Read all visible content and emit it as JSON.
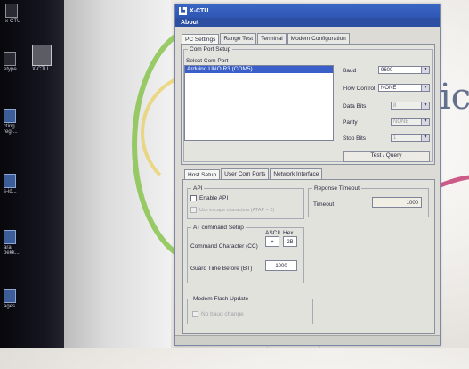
{
  "window": {
    "title": "X-CTU",
    "menu": [
      "About"
    ],
    "tabs": [
      "PC Settings",
      "Range Test",
      "Terminal",
      "Modem Configuration"
    ],
    "active_tab": "PC Settings"
  },
  "desktop": {
    "icons": [
      "x-CTU",
      "X-CTU",
      "etype",
      "cting\nreg-...",
      "s-id...",
      "ara\nbekk...",
      "ages"
    ]
  },
  "background": {
    "logo_fragment": "ic"
  },
  "com_port": {
    "legend": "Com Port Setup",
    "select_label": "Select Com Port",
    "ports": [
      "Arduino UNO R3 (COM5)"
    ],
    "settings": [
      {
        "label": "Baud",
        "value": "9600",
        "enabled": true
      },
      {
        "label": "Flow Control",
        "value": "NONE",
        "enabled": true
      },
      {
        "label": "Data Bits",
        "value": "8",
        "enabled": false
      },
      {
        "label": "Parity",
        "value": "NONE",
        "enabled": false
      },
      {
        "label": "Stop Bits",
        "value": "1",
        "enabled": false
      }
    ],
    "test_button": "Test / Query"
  },
  "host": {
    "tabs": [
      "Host Setup",
      "User Com Ports",
      "Network Interface"
    ],
    "active_tab": "Host Setup",
    "api": {
      "legend": "API",
      "enable_api": "Enable API",
      "escape_chars": "Use escape characters (ATAP = 2)"
    },
    "at": {
      "legend": "AT command Setup",
      "ascii_header": "ASCII",
      "hex_header": "Hex",
      "command_char_label": "Command Character (CC)",
      "command_char_ascii": "+",
      "command_char_hex": "2B",
      "guard_label": "Guard Time Before (BT)",
      "guard_value": "1000"
    },
    "response_timeout": {
      "legend": "Reponse Timeout",
      "label": "Timeout",
      "value": "1000"
    },
    "modem_flash": {
      "legend": "Modem Flash Update",
      "no_baud": "No baud change"
    }
  }
}
